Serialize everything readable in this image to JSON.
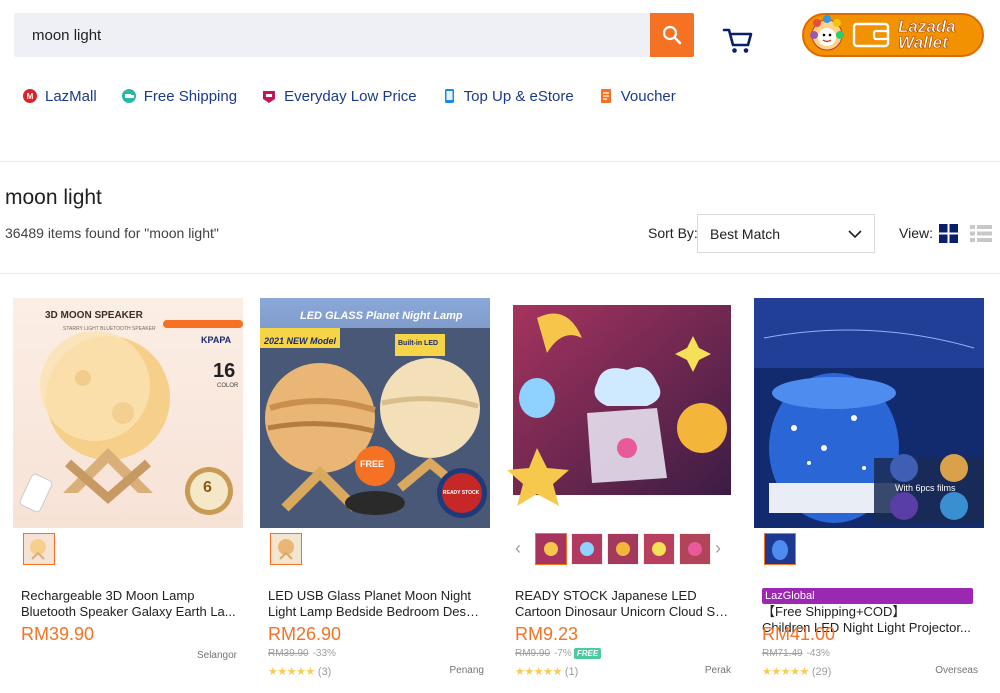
{
  "search": {
    "value": "moon light"
  },
  "wallet": {
    "line1": "Lazada",
    "line2": "Wallet"
  },
  "nav": [
    {
      "label": "LazMall",
      "icon": "lazmall-icon",
      "color": "#d9232d"
    },
    {
      "label": "Free Shipping",
      "icon": "free-shipping-icon",
      "color": "#2bb5a6"
    },
    {
      "label": "Everyday Low Price",
      "icon": "low-price-icon",
      "color": "#c2185b"
    },
    {
      "label": "Top Up & eStore",
      "icon": "topup-icon",
      "color": "#1e88e5"
    },
    {
      "label": "Voucher",
      "icon": "voucher-icon",
      "color": "#f57224"
    }
  ],
  "results": {
    "title": "moon light",
    "count_text": "36489 items found for \"moon light\"",
    "sort_label": "Sort By:",
    "sort_value": "Best Match",
    "view_label": "View:"
  },
  "products": [
    {
      "name1": "Rechargeable 3D Moon Lamp",
      "name2": "Bluetooth Speaker Galaxy Earth La...",
      "price": "RM39.90",
      "location": "Selangor",
      "thumb_text": "3D MOON SPEAKER",
      "thumb_sub": "STARRY LIGHT BLUETOOTH SPEAKER",
      "thumb_brand": "KPAPA",
      "thumb_num": "16",
      "thumb_color": "COLOR",
      "thumb_warranty": "6"
    },
    {
      "name1": "LED USB Glass Planet Moon Night",
      "name2": "Light Lamp Bedside Bedroom Desk...",
      "price": "RM26.90",
      "original": "RM39.90",
      "discount": "-33%",
      "stars": "★★★★★",
      "reviews": "(3)",
      "location": "Penang",
      "thumb_title": "LED GLASS Planet Night Lamp",
      "thumb_model": "2021 NEW Model",
      "thumb_led": "Built-in LED",
      "thumb_free": "FREE",
      "thumb_stock": "READY STOCK"
    },
    {
      "name1": "READY STOCK Japanese LED",
      "name2": "Cartoon Dinosaur Unicorn Cloud Sta...",
      "price": "RM9.23",
      "original": "RM9.90",
      "discount": "-7%",
      "free_tag": "FREE",
      "stars": "★★★★★",
      "reviews": "(1)",
      "location": "Perak"
    },
    {
      "badge": "LazGlobal",
      "name1": "【Free Shipping+COD】",
      "name2": "Children LED Night Light Projector...",
      "price": "RM41.00",
      "original": "RM71.49",
      "discount": "-43%",
      "stars": "★★★★★",
      "reviews": "(29)",
      "location": "Overseas",
      "thumb_caption": "With 6pcs films"
    }
  ],
  "colors": {
    "accent": "#f57224",
    "nav_text": "#1a3a8a",
    "star": "#faca51"
  }
}
